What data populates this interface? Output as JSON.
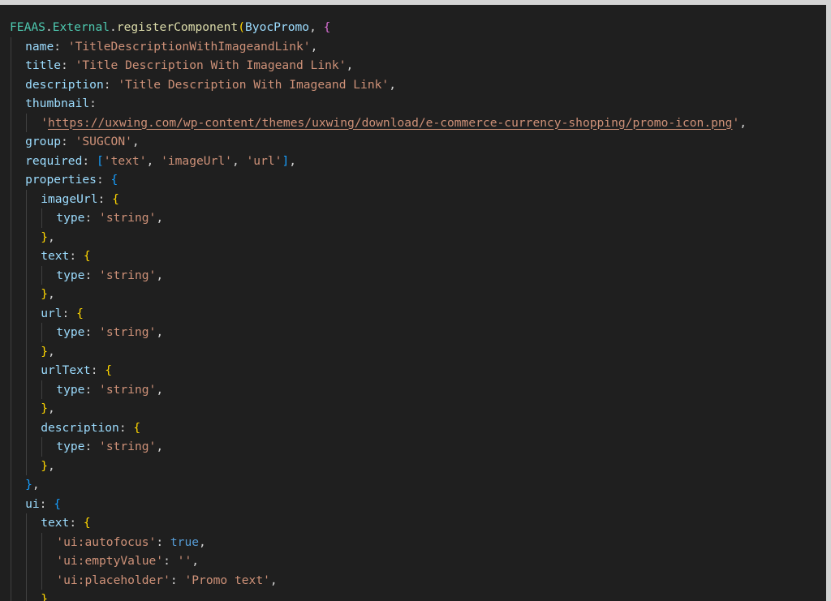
{
  "colors": {
    "background": "#1f1f1f",
    "default": "#d4d4d4",
    "namespace": "#4ec9b0",
    "function": "#dcdcaa",
    "property": "#9cdcfe",
    "string": "#ce9178",
    "keyword": "#569cd6",
    "bracket_level1": "#da70d6",
    "bracket_level2": "#ffd700",
    "bracket_level3": "#179fff",
    "indent_guide": "#404040"
  },
  "code_lines": [
    {
      "indent": 0,
      "tokens": [
        {
          "t": "FEAAS",
          "c": "ns"
        },
        {
          "t": ".",
          "c": "default"
        },
        {
          "t": "External",
          "c": "ns"
        },
        {
          "t": ".",
          "c": "default"
        },
        {
          "t": "registerComponent",
          "c": "fn"
        },
        {
          "t": "(",
          "c": "b2"
        },
        {
          "t": "ByocPromo",
          "c": "key"
        },
        {
          "t": ", ",
          "c": "default"
        },
        {
          "t": "{",
          "c": "b1"
        }
      ]
    },
    {
      "indent": 1,
      "tokens": [
        {
          "t": "name",
          "c": "key"
        },
        {
          "t": ": ",
          "c": "default"
        },
        {
          "t": "'TitleDescriptionWithImageandLink'",
          "c": "str"
        },
        {
          "t": ",",
          "c": "default"
        }
      ]
    },
    {
      "indent": 1,
      "tokens": [
        {
          "t": "title",
          "c": "key"
        },
        {
          "t": ": ",
          "c": "default"
        },
        {
          "t": "'Title Description With Imageand Link'",
          "c": "str"
        },
        {
          "t": ",",
          "c": "default"
        }
      ]
    },
    {
      "indent": 1,
      "tokens": [
        {
          "t": "description",
          "c": "key"
        },
        {
          "t": ": ",
          "c": "default"
        },
        {
          "t": "'Title Description With Imageand Link'",
          "c": "str"
        },
        {
          "t": ",",
          "c": "default"
        }
      ]
    },
    {
      "indent": 1,
      "tokens": [
        {
          "t": "thumbnail",
          "c": "key"
        },
        {
          "t": ":",
          "c": "default"
        }
      ]
    },
    {
      "indent": 2,
      "tokens": [
        {
          "t": "'",
          "c": "str"
        },
        {
          "t": "https://uxwing.com/wp-content/themes/uxwing/download/e-commerce-currency-shopping/promo-icon.png",
          "c": "link"
        },
        {
          "t": "'",
          "c": "str"
        },
        {
          "t": ",",
          "c": "default"
        }
      ]
    },
    {
      "indent": 1,
      "tokens": [
        {
          "t": "group",
          "c": "key"
        },
        {
          "t": ": ",
          "c": "default"
        },
        {
          "t": "'SUGCON'",
          "c": "str"
        },
        {
          "t": ",",
          "c": "default"
        }
      ]
    },
    {
      "indent": 1,
      "tokens": [
        {
          "t": "required",
          "c": "key"
        },
        {
          "t": ": ",
          "c": "default"
        },
        {
          "t": "[",
          "c": "b3"
        },
        {
          "t": "'text'",
          "c": "str"
        },
        {
          "t": ", ",
          "c": "default"
        },
        {
          "t": "'imageUrl'",
          "c": "str"
        },
        {
          "t": ", ",
          "c": "default"
        },
        {
          "t": "'url'",
          "c": "str"
        },
        {
          "t": "]",
          "c": "b3"
        },
        {
          "t": ",",
          "c": "default"
        }
      ]
    },
    {
      "indent": 1,
      "tokens": [
        {
          "t": "properties",
          "c": "key"
        },
        {
          "t": ": ",
          "c": "default"
        },
        {
          "t": "{",
          "c": "b3"
        }
      ]
    },
    {
      "indent": 2,
      "tokens": [
        {
          "t": "imageUrl",
          "c": "key"
        },
        {
          "t": ": ",
          "c": "default"
        },
        {
          "t": "{",
          "c": "b2"
        }
      ]
    },
    {
      "indent": 3,
      "tokens": [
        {
          "t": "type",
          "c": "key"
        },
        {
          "t": ": ",
          "c": "default"
        },
        {
          "t": "'string'",
          "c": "str"
        },
        {
          "t": ",",
          "c": "default"
        }
      ]
    },
    {
      "indent": 2,
      "tokens": [
        {
          "t": "}",
          "c": "b2"
        },
        {
          "t": ",",
          "c": "default"
        }
      ]
    },
    {
      "indent": 2,
      "tokens": [
        {
          "t": "text",
          "c": "key"
        },
        {
          "t": ": ",
          "c": "default"
        },
        {
          "t": "{",
          "c": "b2"
        }
      ]
    },
    {
      "indent": 3,
      "tokens": [
        {
          "t": "type",
          "c": "key"
        },
        {
          "t": ": ",
          "c": "default"
        },
        {
          "t": "'string'",
          "c": "str"
        },
        {
          "t": ",",
          "c": "default"
        }
      ]
    },
    {
      "indent": 2,
      "tokens": [
        {
          "t": "}",
          "c": "b2"
        },
        {
          "t": ",",
          "c": "default"
        }
      ]
    },
    {
      "indent": 2,
      "tokens": [
        {
          "t": "url",
          "c": "key"
        },
        {
          "t": ": ",
          "c": "default"
        },
        {
          "t": "{",
          "c": "b2"
        }
      ]
    },
    {
      "indent": 3,
      "tokens": [
        {
          "t": "type",
          "c": "key"
        },
        {
          "t": ": ",
          "c": "default"
        },
        {
          "t": "'string'",
          "c": "str"
        },
        {
          "t": ",",
          "c": "default"
        }
      ]
    },
    {
      "indent": 2,
      "tokens": [
        {
          "t": "}",
          "c": "b2"
        },
        {
          "t": ",",
          "c": "default"
        }
      ]
    },
    {
      "indent": 2,
      "tokens": [
        {
          "t": "urlText",
          "c": "key"
        },
        {
          "t": ": ",
          "c": "default"
        },
        {
          "t": "{",
          "c": "b2"
        }
      ]
    },
    {
      "indent": 3,
      "tokens": [
        {
          "t": "type",
          "c": "key"
        },
        {
          "t": ": ",
          "c": "default"
        },
        {
          "t": "'string'",
          "c": "str"
        },
        {
          "t": ",",
          "c": "default"
        }
      ]
    },
    {
      "indent": 2,
      "tokens": [
        {
          "t": "}",
          "c": "b2"
        },
        {
          "t": ",",
          "c": "default"
        }
      ]
    },
    {
      "indent": 2,
      "tokens": [
        {
          "t": "description",
          "c": "key"
        },
        {
          "t": ": ",
          "c": "default"
        },
        {
          "t": "{",
          "c": "b2"
        }
      ]
    },
    {
      "indent": 3,
      "tokens": [
        {
          "t": "type",
          "c": "key"
        },
        {
          "t": ": ",
          "c": "default"
        },
        {
          "t": "'string'",
          "c": "str"
        },
        {
          "t": ",",
          "c": "default"
        }
      ]
    },
    {
      "indent": 2,
      "tokens": [
        {
          "t": "}",
          "c": "b2"
        },
        {
          "t": ",",
          "c": "default"
        }
      ]
    },
    {
      "indent": 1,
      "tokens": [
        {
          "t": "}",
          "c": "b3"
        },
        {
          "t": ",",
          "c": "default"
        }
      ]
    },
    {
      "indent": 1,
      "tokens": [
        {
          "t": "ui",
          "c": "key"
        },
        {
          "t": ": ",
          "c": "default"
        },
        {
          "t": "{",
          "c": "b3"
        }
      ]
    },
    {
      "indent": 2,
      "tokens": [
        {
          "t": "text",
          "c": "key"
        },
        {
          "t": ": ",
          "c": "default"
        },
        {
          "t": "{",
          "c": "b2"
        }
      ]
    },
    {
      "indent": 3,
      "tokens": [
        {
          "t": "'ui:autofocus'",
          "c": "str"
        },
        {
          "t": ": ",
          "c": "default"
        },
        {
          "t": "true",
          "c": "kw"
        },
        {
          "t": ",",
          "c": "default"
        }
      ]
    },
    {
      "indent": 3,
      "tokens": [
        {
          "t": "'ui:emptyValue'",
          "c": "str"
        },
        {
          "t": ": ",
          "c": "default"
        },
        {
          "t": "''",
          "c": "str"
        },
        {
          "t": ",",
          "c": "default"
        }
      ]
    },
    {
      "indent": 3,
      "tokens": [
        {
          "t": "'ui:placeholder'",
          "c": "str"
        },
        {
          "t": ": ",
          "c": "default"
        },
        {
          "t": "'Promo text'",
          "c": "str"
        },
        {
          "t": ",",
          "c": "default"
        }
      ]
    },
    {
      "indent": 2,
      "tokens": [
        {
          "t": "}",
          "c": "b2"
        }
      ]
    }
  ]
}
